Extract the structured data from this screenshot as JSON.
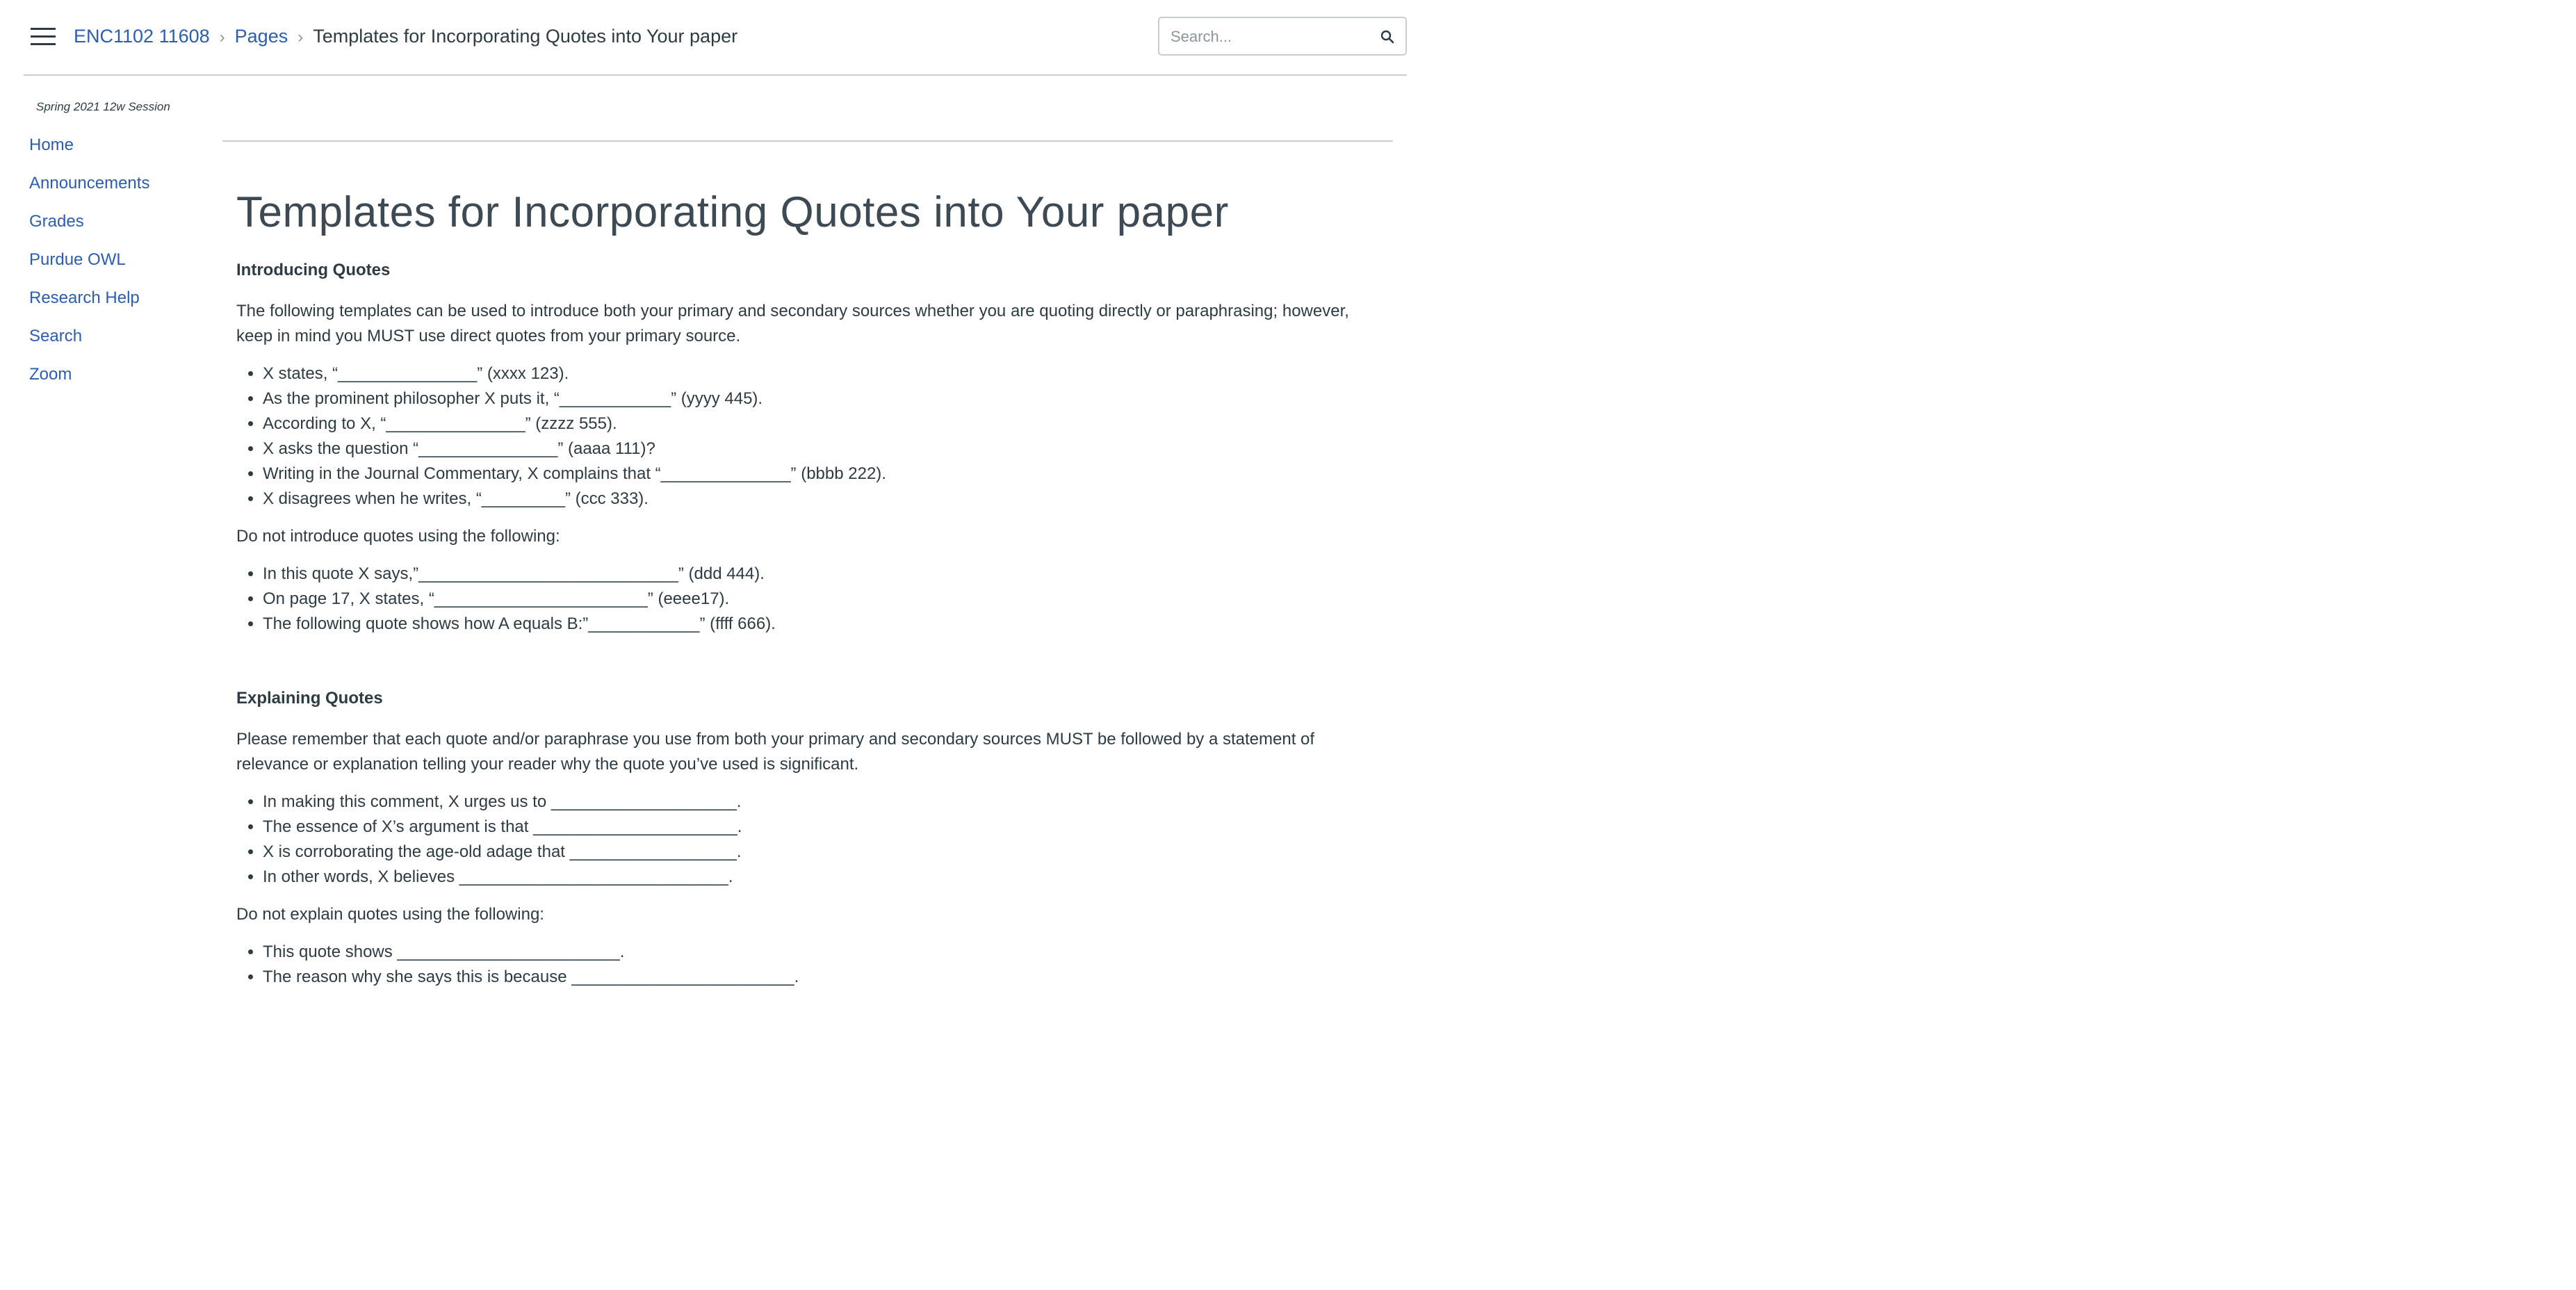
{
  "header": {
    "breadcrumb": {
      "course": "ENC1102 11608",
      "section": "Pages",
      "current": "Templates for Incorporating Quotes into Your paper",
      "separator": "›"
    },
    "search": {
      "placeholder": "Search..."
    }
  },
  "sidebar": {
    "term": "Spring 2021 12w Session",
    "items": [
      {
        "label": "Home"
      },
      {
        "label": "Announcements"
      },
      {
        "label": "Grades"
      },
      {
        "label": "Purdue OWL"
      },
      {
        "label": "Research Help"
      },
      {
        "label": "Search"
      },
      {
        "label": "Zoom"
      }
    ]
  },
  "page": {
    "title": "Templates for Incorporating Quotes into Your paper",
    "introducing": {
      "heading": "Introducing Quotes",
      "intro": "The following templates can be used to introduce both your primary and secondary sources whether you are quoting directly or paraphrasing; however, keep in mind you MUST use direct quotes from your primary source.",
      "good_examples": [
        "X states, “_______________” (xxxx 123).",
        "As the prominent philosopher X puts it, “____________” (yyyy 445).",
        "According to X, “_______________” (zzzz 555).",
        "X asks the question “_______________” (aaaa 111)?",
        "Writing in the Journal Commentary, X complains that “______________” (bbbb 222).",
        "X disagrees when he writes, “_________” (ccc 333)."
      ],
      "avoid_label": "Do not introduce quotes using the following:",
      "bad_examples": [
        "In this quote X says,”____________________________” (ddd 444).",
        "On page 17, X states, “_______________________” (eeee17).",
        "The following quote shows how A equals B:”____________” (ffff 666)."
      ]
    },
    "explaining": {
      "heading": "Explaining Quotes",
      "intro": "Please remember that each quote and/or paraphrase you use from both your primary and secondary sources MUST be followed by a statement of relevance or explanation telling your reader why the quote you’ve used is significant.",
      "good_examples": [
        "In making this comment, X urges us to ____________________.",
        "The essence of X’s argument is that ______________________.",
        "X is corroborating the age-old adage that __________________.",
        "In other words, X believes _____________________________."
      ],
      "avoid_label": "Do not explain quotes using the following:",
      "bad_examples": [
        "This quote shows ________________________.",
        "The reason why she says this is because ________________________."
      ]
    }
  }
}
